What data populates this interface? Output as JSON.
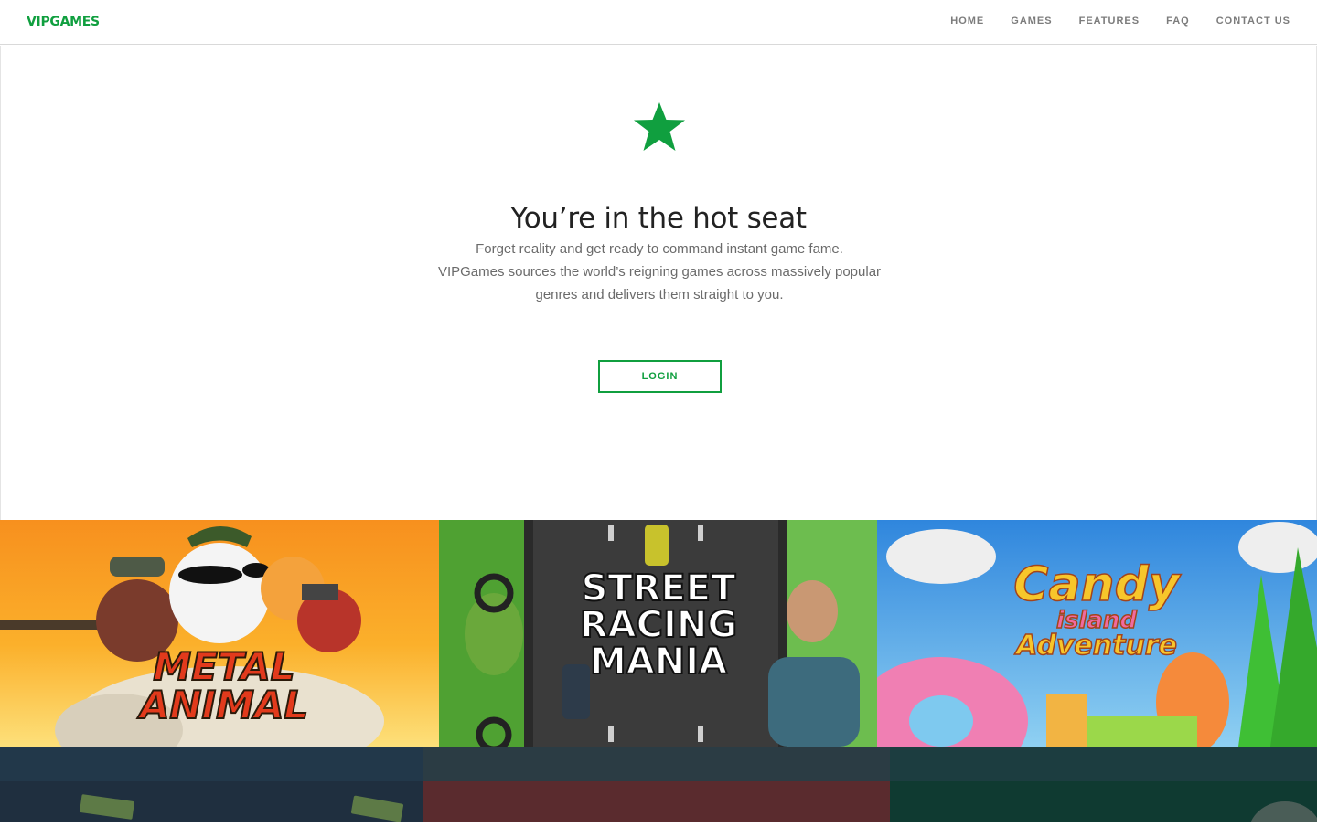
{
  "brand": {
    "logo_text": "VIPGAMES",
    "accent_color": "#109f3f"
  },
  "nav": {
    "items": [
      {
        "label": "HOME"
      },
      {
        "label": "GAMES"
      },
      {
        "label": "FEATURES"
      },
      {
        "label": "FAQ"
      },
      {
        "label": "CONTACT US"
      }
    ]
  },
  "hero": {
    "icon": "star-icon",
    "title": "You’re in the hot seat",
    "line1": "Forget reality and get ready to command instant game fame.",
    "line2": "VIPGames sources the world’s reigning games across massively popular",
    "line3": "genres and delivers them straight to you.",
    "login_label": "LOGIN"
  },
  "games": [
    {
      "title_line1": "METAL",
      "title_line2": "ANIMAL"
    },
    {
      "title_line1": "STREET",
      "title_line2": "RACING",
      "title_line3": "MANIA"
    },
    {
      "title_line1": "Candy",
      "title_line2": "island",
      "title_line3": "Adventure"
    }
  ]
}
